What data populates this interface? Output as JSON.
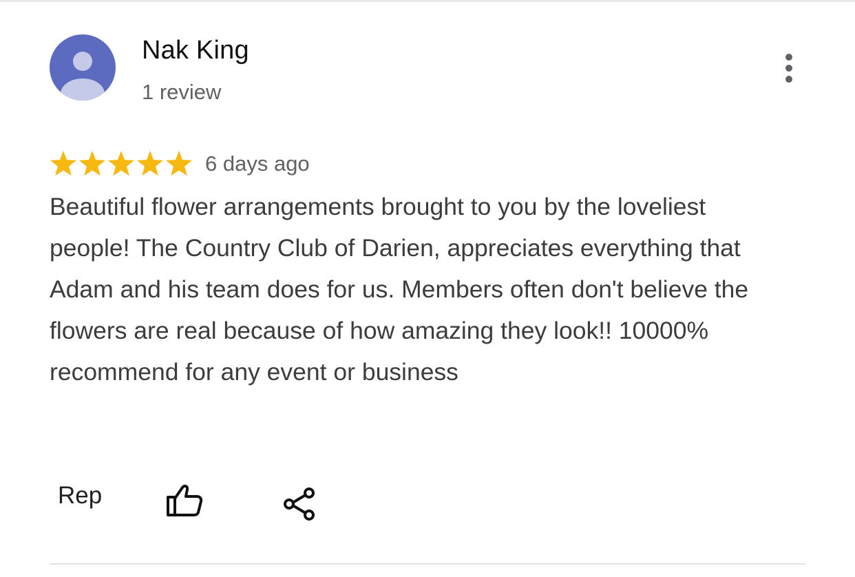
{
  "review": {
    "author": {
      "name": "Nak King",
      "review_count": "1 review",
      "avatar_icon": "person-avatar-icon",
      "avatar_color": "#5c6bc0"
    },
    "menu_icon": "more-vertical-icon",
    "rating": {
      "stars": 5,
      "max": 5,
      "star_color": "#f7b90f"
    },
    "date": "6 days ago",
    "text": "Beautiful flower arrangements brought to you by the loveliest people! The Country Club of Darien, appreciates everything that Adam and his team does for us. Members often don't believe the flowers are real because of how amazing they look!! 10000% recommend for any event or business",
    "actions": {
      "reply_label": "Rep",
      "like_icon": "thumbs-up-icon",
      "share_icon": "share-icon"
    }
  }
}
